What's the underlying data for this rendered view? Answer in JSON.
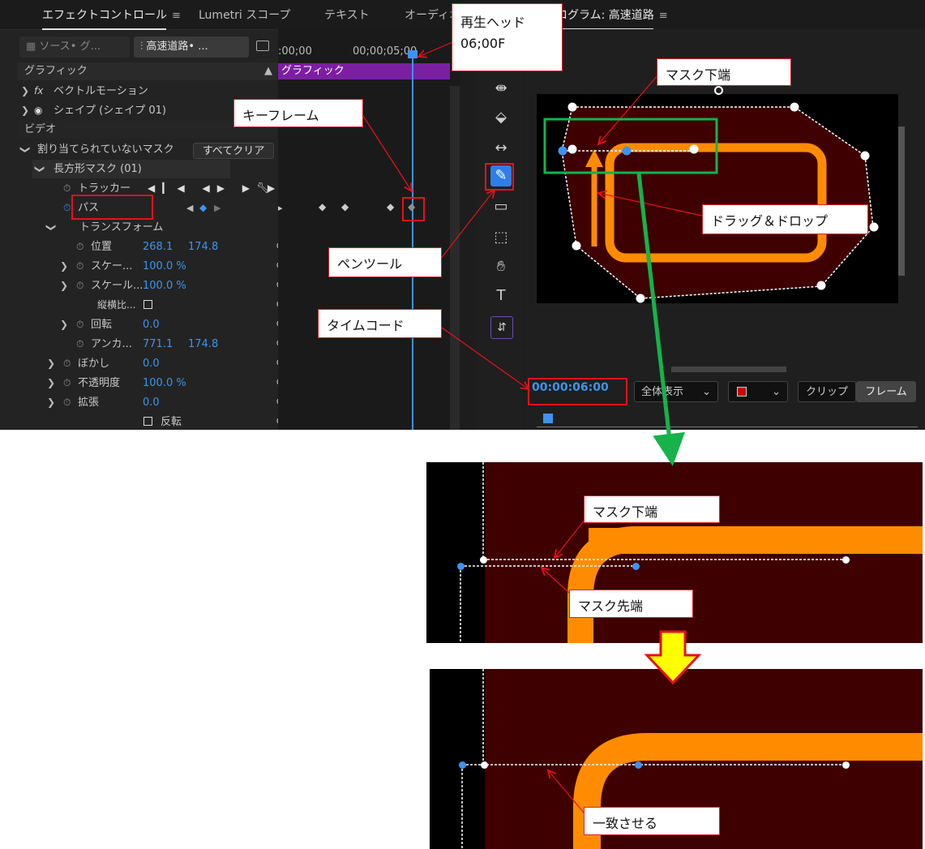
{
  "tabs": {
    "effect_controls": "エフェクトコントロール",
    "lumetri": "Lumetri スコープ",
    "text": "テキスト",
    "audio": "オーディオ",
    "program": "プログラム: 高速道路"
  },
  "source": {
    "source_label": "ソース• グ...",
    "clip_label": "高速道路• ..."
  },
  "timeline": {
    "time_start": ":00;00",
    "time_marker": "00;00;05;00",
    "clip_name": "グラフィック"
  },
  "sections": {
    "graphics": "グラフィック",
    "video": "ビデオ"
  },
  "props": {
    "vector_motion": "ベクトルモーション",
    "shape": "シェイプ (シェイプ 01)",
    "unassigned_mask": "割り当てられていないマスク",
    "clear_all": "すべてクリア",
    "rect_mask": "長方形マスク (01)",
    "tracker": "トラッカー",
    "path": "パス",
    "transform": "トランスフォーム",
    "position": "位置",
    "position_x": "268.1",
    "position_y": "174.8",
    "scale": "スケー...",
    "scale_value": "100.0 %",
    "scale_w": "スケール...",
    "scale_w_value": "100.0 %",
    "aspect": "縦横比...",
    "rotation": "回転",
    "rotation_value": "0.0",
    "anchor": "アンカ...",
    "anchor_x": "771.1",
    "anchor_y": "174.8",
    "blur": "ぼかし",
    "blur_value": "0.0",
    "opacity": "不透明度",
    "opacity_value": "100.0 %",
    "expand": "拡張",
    "expand_value": "0.0",
    "invert": "反転"
  },
  "program": {
    "timecode": "00:00:06:00",
    "fit": "全体表示",
    "clip_btn": "クリップ",
    "frame_btn": "フレーム"
  },
  "callouts": {
    "playhead": "再生ヘッド",
    "playhead_time": "06;00F",
    "mask_bottom": "マスク下端",
    "keyframe": "キーフレーム",
    "drag_drop": "ドラッグ＆ドロップ",
    "pen_tool": "ペンツール",
    "timecode": "タイムコード",
    "mask_bottom2": "マスク下端",
    "mask_tip": "マスク先端",
    "match": "一致させる"
  },
  "colors": {
    "accent_blue": "#3c94f0",
    "red": "#e8101a",
    "green": "#15b34a",
    "orange": "#ff8c00",
    "mask_fill": "#3e0000",
    "arrow_yellow": "#ffff00"
  },
  "icons": [
    "hamburger-menu-icon",
    "fx-icon",
    "eye-icon",
    "stopwatch-icon",
    "reset-icon",
    "wrench-icon",
    "pen-icon",
    "hand-icon",
    "type-icon",
    "rectangle-icon",
    "select-track-icon",
    "ripple-edit-icon",
    "razor-icon",
    "slip-icon"
  ]
}
